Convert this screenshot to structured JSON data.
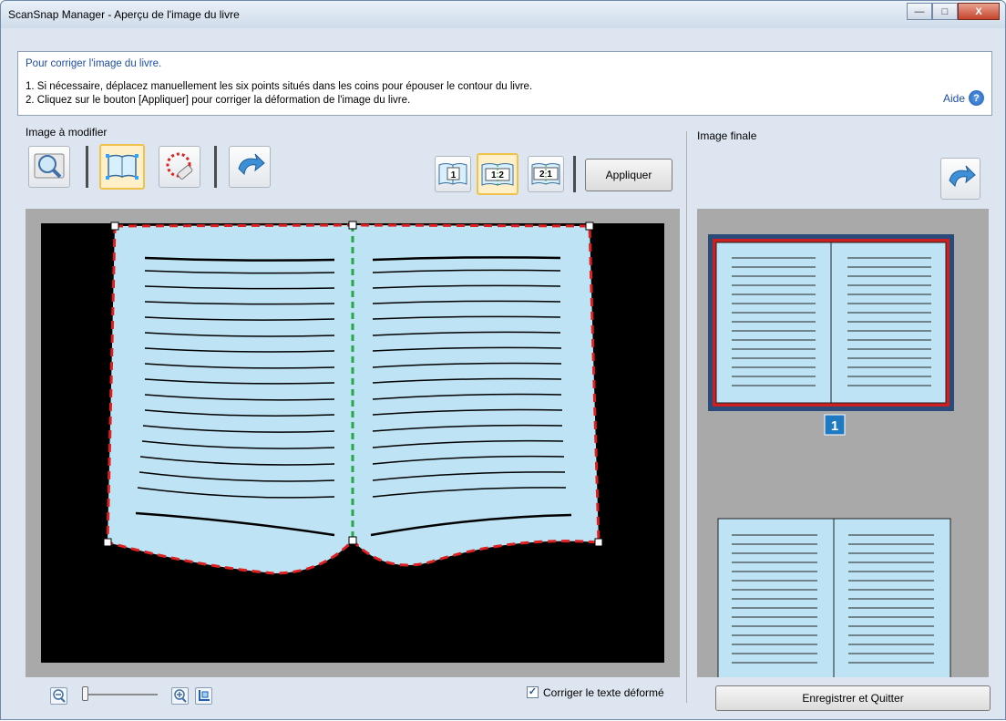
{
  "window": {
    "title": "ScanSnap Manager - Aperçu de l'image du livre"
  },
  "info": {
    "heading": "Pour corriger l'image du livre.",
    "line1": "1. Si nécessaire, déplacez manuellement les six points situés dans les coins pour épouser le contour du livre.",
    "line2": "2. Cliquez sur le bouton [Appliquer] pour corriger la déformation de l'image du livre.",
    "help_label": "Aide"
  },
  "left": {
    "label": "Image à modifier",
    "page_buttons": [
      "1",
      "1 2",
      "2 1"
    ],
    "apply_label": "Appliquer"
  },
  "right": {
    "label": "Image finale",
    "page_number": "1"
  },
  "bottom": {
    "correct_text_label": "Corriger le texte déformé",
    "correct_text_checked": true,
    "save_quit_label": "Enregistrer et Quitter"
  },
  "icons": {
    "minimize": "minimize-icon",
    "maximize": "maximize-icon",
    "close": "close-icon",
    "help": "help-icon",
    "magnifier": "magnifier-icon",
    "book": "book-icon",
    "eraser": "eraser-icon",
    "undo": "undo-icon",
    "zoom_out": "zoom-out-icon",
    "zoom_in": "zoom-in-icon",
    "fit": "fit-icon"
  },
  "colors": {
    "accent": "#f0c24c",
    "page": "#bde3f4",
    "outline": "#e02020",
    "spine": "#22aa44",
    "selection": "#cc1f1f"
  }
}
